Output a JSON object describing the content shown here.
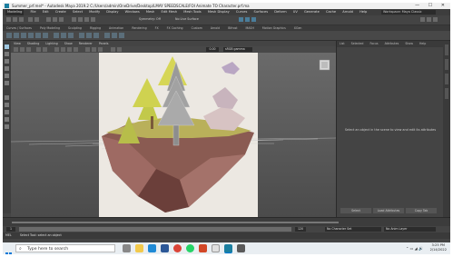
{
  "window": {
    "title": "Summer_prf.mel* - Autodesk Maya 2019.2 C:/Users/admin/OneDrive/Desktop/LMAY SPEEDSCALE/FOI Animate TO Character.prf.ma"
  },
  "menubar": {
    "items": [
      "File",
      "Edit",
      "Create",
      "Select",
      "Modify",
      "Display",
      "Windows",
      "Mesh",
      "Edit Mesh",
      "Mesh Tools",
      "Mesh Display",
      "Curves",
      "Surfaces",
      "Deform",
      "UV",
      "Generate",
      "Cache",
      "Arnold",
      "Help"
    ],
    "workspace": "Workspace: Maya Classic"
  },
  "status": {
    "mode": "Modeling",
    "no_live": "No Live Surface",
    "symmetry": "Symmetry: Off"
  },
  "shelf_tabs": [
    "Curves / Surfaces",
    "Poly Modeling",
    "Sculpting",
    "Rigging",
    "Animation",
    "Rendering",
    "FX",
    "FX Caching",
    "Custom",
    "Arnold",
    "Bifrost",
    "MASH",
    "Motion Graphics",
    "XGen"
  ],
  "viewport": {
    "menu": [
      "View",
      "Shading",
      "Lighting",
      "Show",
      "Renderer",
      "Panels"
    ],
    "field_value": "0.00",
    "gamma": "sRGB gamma"
  },
  "attribute_panel": {
    "tabs": [
      "List",
      "Selected",
      "Focus",
      "Attributes",
      "Show",
      "Help"
    ],
    "message": "Select an object in the scene to view and edit its attributes",
    "buttons": [
      "Select",
      "Load Attributes",
      "Copy Tab"
    ]
  },
  "range": {
    "start": "1",
    "end": "120",
    "char_set": "No Character Set",
    "anim_layer": "No Anim Layer"
  },
  "command": {
    "lang": "MEL",
    "text": "Select Tool: select an object"
  },
  "taskbar": {
    "search_placeholder": "Type here to search",
    "time": "3:25 PM",
    "date": "2/14/2022",
    "colors": {
      "maya": "#1b7fa0",
      "chrome": "#db4437",
      "whatsapp": "#25d366",
      "folder": "#f2c94c",
      "edge": "#1f8ad6",
      "store": "#2b5797"
    }
  }
}
